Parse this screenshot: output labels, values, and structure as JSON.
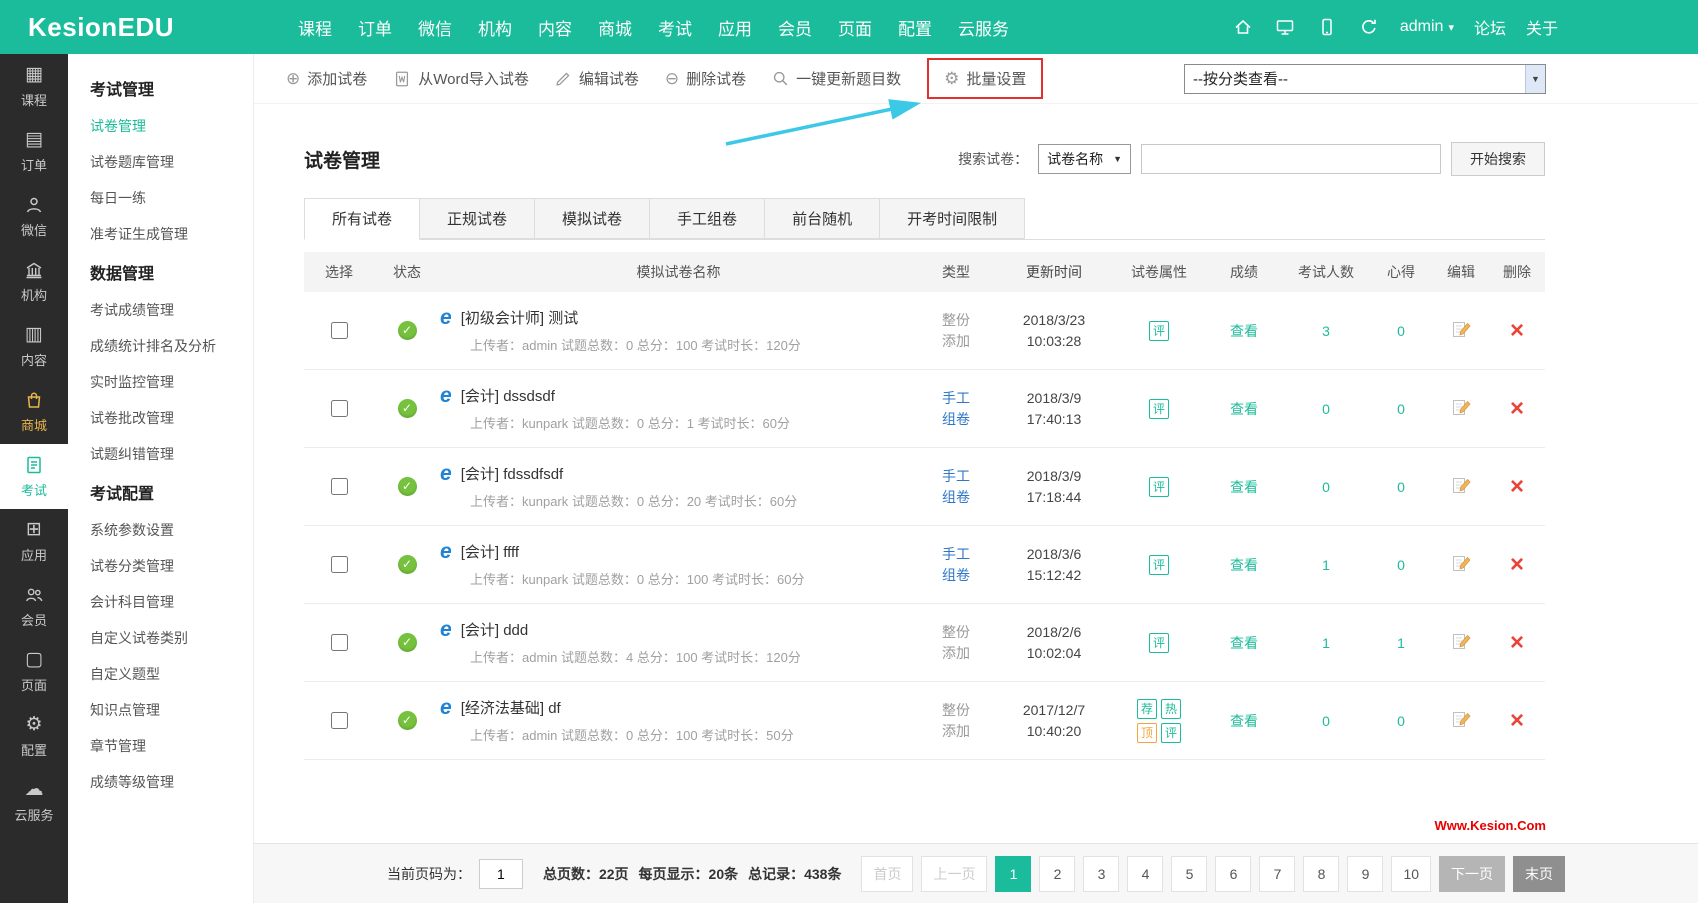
{
  "topbar": {
    "logo": "KesionEDU",
    "nav": [
      "课程",
      "订单",
      "微信",
      "机构",
      "内容",
      "商城",
      "考试",
      "应用",
      "会员",
      "页面",
      "配置",
      "云服务"
    ],
    "user": "admin",
    "forum": "论坛",
    "about": "关于"
  },
  "rail": {
    "items": [
      "课程",
      "订单",
      "微信",
      "机构",
      "内容",
      "商城",
      "考试",
      "应用",
      "会员",
      "页面",
      "配置",
      "云服务"
    ]
  },
  "submenu": {
    "groups": [
      {
        "title": "考试管理",
        "items": [
          "试卷管理",
          "试卷题库管理",
          "每日一练",
          "准考证生成管理"
        ]
      },
      {
        "title": "数据管理",
        "items": [
          "考试成绩管理",
          "成绩统计排名及分析",
          "实时监控管理",
          "试卷批改管理",
          "试题纠错管理"
        ]
      },
      {
        "title": "考试配置",
        "items": [
          "系统参数设置",
          "试卷分类管理",
          "会计科目管理",
          "自定义试卷类别",
          "自定义题型",
          "知识点管理",
          "章节管理",
          "成绩等级管理"
        ]
      }
    ]
  },
  "toolbar": {
    "add": "添加试卷",
    "import_word": "从Word导入试卷",
    "edit": "编辑试卷",
    "delete": "删除试卷",
    "update_count": "一键更新题目数",
    "batch": "批量设置",
    "category_select": "--按分类查看--"
  },
  "main": {
    "title": "试卷管理"
  },
  "search": {
    "label": "搜索试卷：",
    "field": "试卷名称",
    "button": "开始搜索"
  },
  "tabs": [
    "所有试卷",
    "正规试卷",
    "模拟试卷",
    "手工组卷",
    "前台随机",
    "开考时间限制"
  ],
  "table": {
    "headers": [
      "选择",
      "状态",
      "模拟试卷名称",
      "类型",
      "更新时间",
      "试卷属性",
      "成绩",
      "考试人数",
      "心得",
      "编辑",
      "删除"
    ],
    "rows": [
      {
        "name": "[初级会计师] 测试",
        "meta": "上传者：admin 试题总数：0 总分：100 考试时长：120分",
        "type1": "整份",
        "type2": "添加",
        "date": "2018/3/23",
        "time": "10:03:28",
        "attrs": [
          "评"
        ],
        "score": "查看",
        "examinees": "3",
        "notes": "0"
      },
      {
        "name": "[会计] dssdsdf",
        "meta": "上传者：kunpark 试题总数：0 总分：1 考试时长：60分",
        "type1": "手工",
        "type2": "组卷",
        "date": "2018/3/9",
        "time": "17:40:13",
        "attrs": [
          "评"
        ],
        "score": "查看",
        "examinees": "0",
        "notes": "0"
      },
      {
        "name": "[会计] fdssdfsdf",
        "meta": "上传者：kunpark 试题总数：0 总分：20 考试时长：60分",
        "type1": "手工",
        "type2": "组卷",
        "date": "2018/3/9",
        "time": "17:18:44",
        "attrs": [
          "评"
        ],
        "score": "查看",
        "examinees": "0",
        "notes": "0"
      },
      {
        "name": "[会计] ffff",
        "meta": "上传者：kunpark 试题总数：0 总分：100 考试时长：60分",
        "type1": "手工",
        "type2": "组卷",
        "date": "2018/3/6",
        "time": "15:12:42",
        "attrs": [
          "评"
        ],
        "score": "查看",
        "examinees": "1",
        "notes": "0"
      },
      {
        "name": "[会计] ddd",
        "meta": "上传者：admin 试题总数：4 总分：100 考试时长：120分",
        "type1": "整份",
        "type2": "添加",
        "date": "2018/2/6",
        "time": "10:02:04",
        "attrs": [
          "评"
        ],
        "score": "查看",
        "examinees": "1",
        "notes": "1"
      },
      {
        "name": "[经济法基础] df",
        "meta": "上传者：admin 试题总数：0 总分：100 考试时长：50分",
        "type1": "整份",
        "type2": "添加",
        "date": "2017/12/7",
        "time": "10:40:20",
        "attrs": [
          "荐",
          "热",
          "顶",
          "评"
        ],
        "score": "查看",
        "examinees": "0",
        "notes": "0"
      }
    ]
  },
  "pagination": {
    "current_label": "当前页码为：",
    "current_value": "1",
    "total_pages": "总页数：22页",
    "per_page": "每页显示：20条",
    "total_records": "总记录：438条",
    "first": "首页",
    "prev": "上一页",
    "pages": [
      "1",
      "2",
      "3",
      "4",
      "5",
      "6",
      "7",
      "8",
      "9",
      "10"
    ],
    "next": "下一页",
    "last": "末页"
  },
  "watermark": "Www.Kesion.Com",
  "colors": {
    "accent": "#1bbc9b",
    "type_blue": "#2e77c8",
    "status_green": "#76c13e",
    "delete_red": "#e8443a",
    "annotation_red": "#e03131",
    "arrow_cyan": "#3cc9e8",
    "tag_orange": "#f0a63c",
    "watermark_red": "#e80000"
  }
}
